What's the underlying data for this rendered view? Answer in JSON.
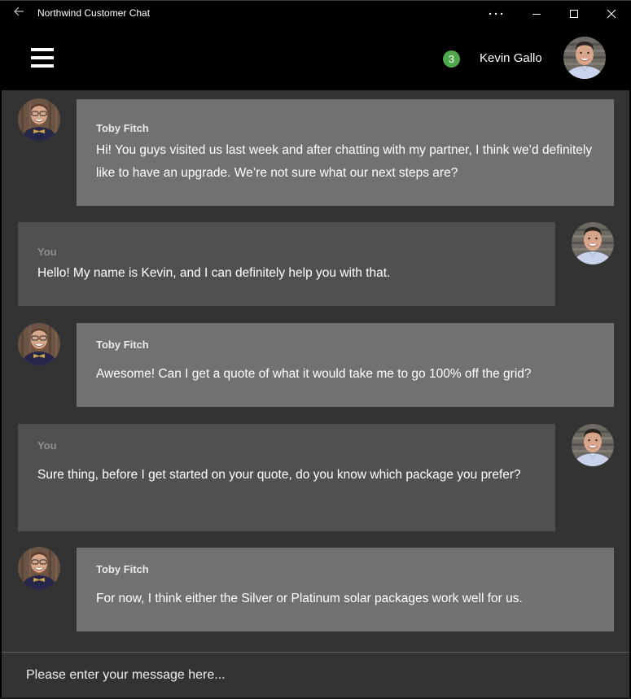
{
  "window": {
    "title": "Northwind Customer Chat",
    "back_icon": "back-arrow-icon",
    "more_icon": "more-options-icon",
    "minimize_icon": "minimize-icon",
    "maximize_icon": "maximize-icon",
    "close_icon": "close-icon"
  },
  "header": {
    "menu_icon": "hamburger-menu-icon",
    "notification_count": "3",
    "user_name": "Kevin Gallo",
    "badge_color": "#4fa84c"
  },
  "messages": [
    {
      "sender": "Toby Fitch",
      "from_me": false,
      "text": "Hi! You guys visited us last week and after chatting with my partner, I think we’d definitely like to have an upgrade. We’re not sure what our next steps are?"
    },
    {
      "sender": "You",
      "from_me": true,
      "text": "Hello! My name is Kevin, and I can definitely help you with that."
    },
    {
      "sender": "Toby Fitch",
      "from_me": false,
      "text": "Awesome! Can I get a quote of what it would take me to go 100% off the grid?"
    },
    {
      "sender": "You",
      "from_me": true,
      "text": "Sure thing, before I get started on your quote, do you know which package you prefer?"
    },
    {
      "sender": "Toby Fitch",
      "from_me": false,
      "text": "For now, I think either the Silver or Platinum solar packages work well for us."
    }
  ],
  "composer": {
    "value": "",
    "placeholder": "Please enter your message here..."
  },
  "colors": {
    "them_bubble": "#717171",
    "me_bubble": "#505050",
    "chat_bg": "#333333"
  }
}
